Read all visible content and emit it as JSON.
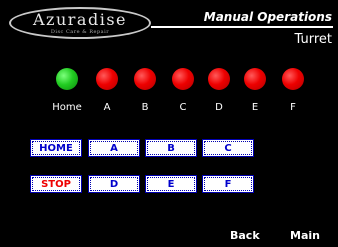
{
  "header": {
    "logo_name": "Azuradise",
    "logo_tagline": "Disc Care & Repair",
    "title": "Manual Operations",
    "subtitle": "Turret"
  },
  "indicators": [
    {
      "label": "Home",
      "color": "green"
    },
    {
      "label": "A",
      "color": "red"
    },
    {
      "label": "B",
      "color": "red"
    },
    {
      "label": "C",
      "color": "red"
    },
    {
      "label": "D",
      "color": "red"
    },
    {
      "label": "E",
      "color": "red"
    },
    {
      "label": "F",
      "color": "red"
    }
  ],
  "buttons": {
    "home": "HOME",
    "a": "A",
    "b": "B",
    "c": "C",
    "stop": "STOP",
    "d": "D",
    "e": "E",
    "f": "F"
  },
  "nav": {
    "back": "Back",
    "main": "Main"
  },
  "colors": {
    "background": "#000000",
    "indicator_on": "#22cc22",
    "indicator_off": "#ee0000",
    "button_text": "#0000cc",
    "stop_text": "#ee0000"
  }
}
